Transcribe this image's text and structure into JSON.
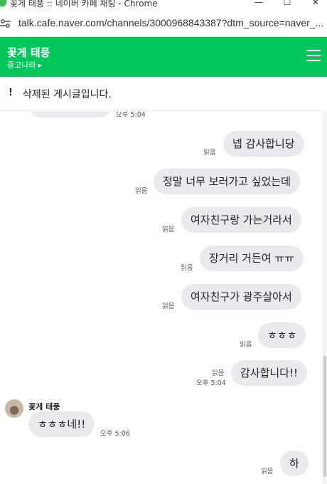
{
  "window": {
    "title": "꽃게 태풍 :: 네이버 카페 채팅 - Chrome",
    "min_glyph": "—",
    "max_glyph": "☐",
    "close_glyph": "✕"
  },
  "browser": {
    "url": "talk.cafe.naver.com/channels/3000968843387?dtm_source=naver_..."
  },
  "header": {
    "title": "꽃게 태풍",
    "subtitle": "중고나라",
    "subtitle_chevron": "▶"
  },
  "notice": {
    "icon": "!",
    "text": "삭제된 게시글입니다."
  },
  "messages": {
    "top_time": "오후 5:04",
    "m1": {
      "text": "넵 감사합니당",
      "read": "읽음"
    },
    "m2": {
      "text": "정말 너무 보러가고 싶었는데",
      "read": "읽음"
    },
    "m3": {
      "text": "여자친구랑 가는거라서",
      "read": "읽음"
    },
    "m4": {
      "text": "장거리 거든여 ㅠㅠ",
      "read": "읽음"
    },
    "m5": {
      "text": "여자친구가 광주살아서",
      "read": "읽음"
    },
    "m6": {
      "text": "ㅎㅎㅎ",
      "read": "읽음"
    },
    "m7": {
      "text": "감사합니다!!",
      "read": "읽음",
      "time": "오후 5:04"
    },
    "incoming": {
      "sender": "꽃게 태풍",
      "text": "ㅎㅎㅎ네!!",
      "time": "오후 5:06"
    },
    "m8": {
      "text": "하",
      "read": "읽음"
    }
  },
  "colors": {
    "brand": "#03c75a",
    "bubble": "#e8eaee"
  },
  "icons": {
    "url": "site-settings-icon",
    "menu": "hamburger-menu-icon",
    "notice": "exclamation-icon"
  }
}
